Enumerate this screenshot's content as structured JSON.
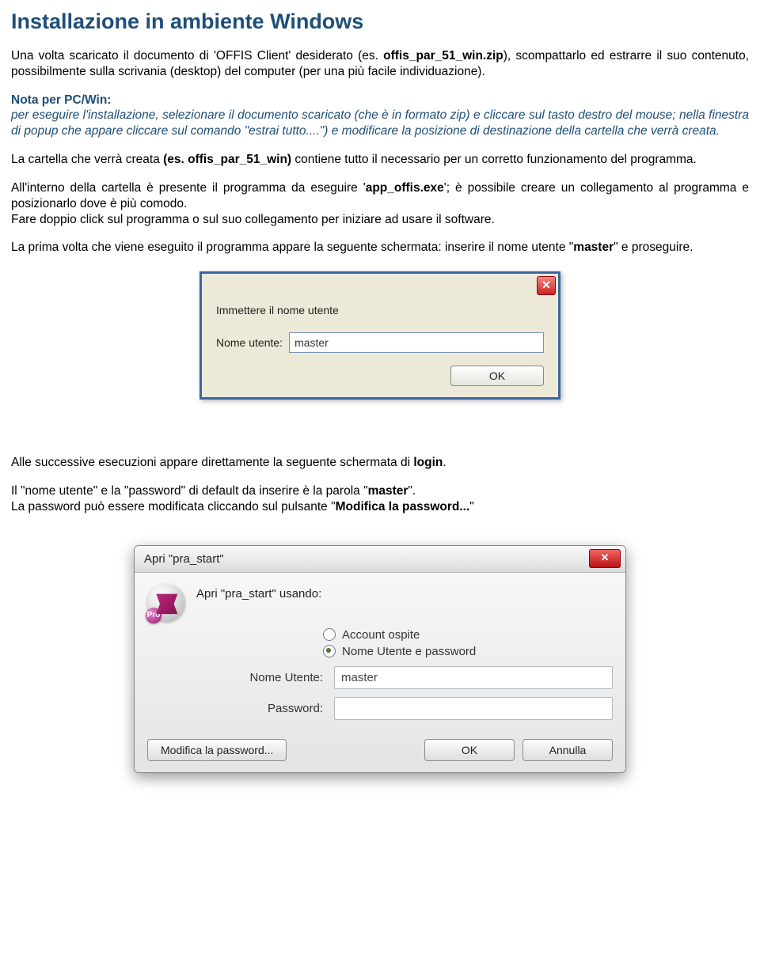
{
  "title": "Installazione in ambiente Windows",
  "p1_a": "Una volta scaricato il documento di 'OFFIS Client' desiderato (es. ",
  "p1_b": "offis_par_51_win.zip",
  "p1_c": "), scompattarlo ed estrarre il suo contenuto, possibilmente sulla scrivania (desktop) del computer (per una più facile individuazione).",
  "nota_label": "Nota per PC/Win",
  "nota_colon": ":",
  "nota_text": "per eseguire l'installazione, selezionare il documento scaricato (che è in formato zip) e cliccare sul tasto destro del mouse; nella finestra di popup che appare cliccare sul comando \"estrai tutto....\") e modificare la posizione di destinazione della cartella che verrà creata.",
  "p2_a": "La cartella che verrà creata ",
  "p2_b": "(es. offis_par_51_win)",
  "p2_c": " contiene tutto il necessario per un corretto funzionamento del programma.",
  "p3_a": "All'interno della cartella è presente il programma da eseguire '",
  "p3_b": "app_offis.exe",
  "p3_c": "'; è possibile creare un collegamento al programma e posizionarlo dove è più comodo.",
  "p3_d": "Fare doppio click sul programma o sul suo collegamento per iniziare ad usare il software.",
  "p4_a": "La prima volta che viene eseguito il programma appare la seguente schermata: inserire il nome utente \"",
  "p4_b": "master",
  "p4_c": "\" e proseguire.",
  "dialog1": {
    "prompt": "Immettere il nome utente",
    "label": "Nome utente:",
    "value": "master",
    "ok": "OK",
    "close": "✕"
  },
  "p5_a": "Alle successive esecuzioni appare direttamente la seguente schermata di ",
  "p5_b": "login",
  "p5_c": ".",
  "p6_a": "Il \"nome utente\" e la \"password\" di default da inserire è la parola \"",
  "p6_b": "master",
  "p6_c": "\".",
  "p6_d": "La password può essere modificata cliccando sul pulsante \"",
  "p6_e": "Modifica la password...",
  "p6_f": "\"",
  "dialog2": {
    "title": "Apri \"pra_start\"",
    "usando": "Apri \"pra_start\" usando:",
    "icon_badge": "Pro",
    "radio_guest": "Account ospite",
    "radio_user": "Nome Utente e password",
    "label_user": "Nome Utente:",
    "value_user": "master",
    "label_pass": "Password:",
    "value_pass": "",
    "btn_modify": "Modifica la password...",
    "btn_ok": "OK",
    "btn_cancel": "Annulla",
    "close": "✕"
  }
}
